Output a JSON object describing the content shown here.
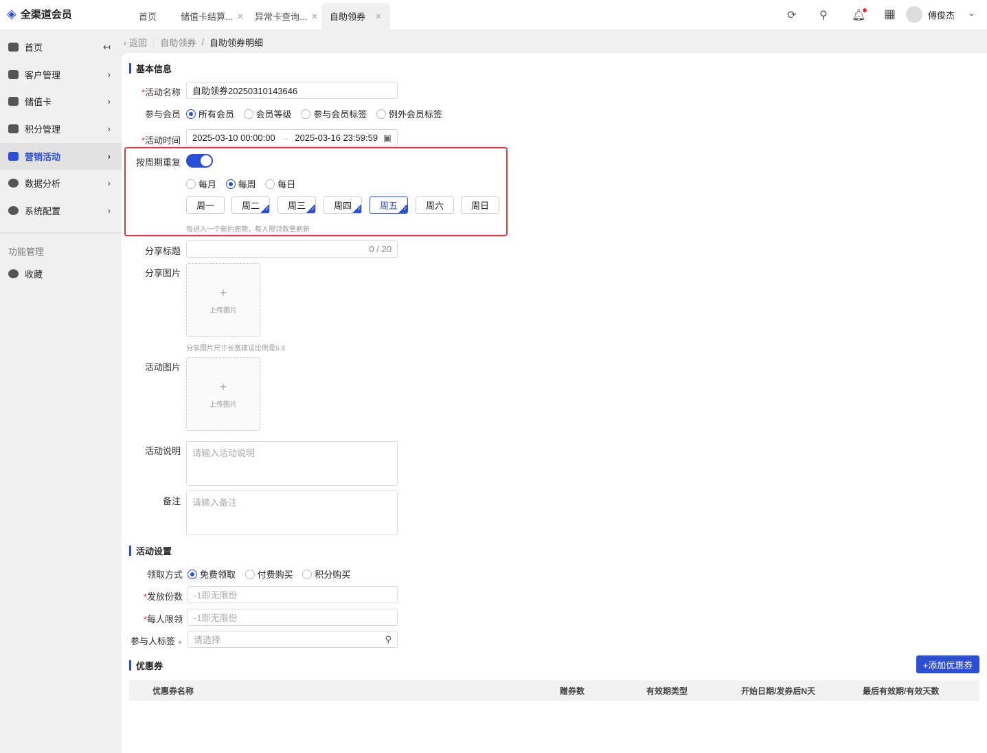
{
  "app": {
    "title": "全渠道会员"
  },
  "tabs": [
    {
      "label": "首页"
    },
    {
      "label": "储值卡结算..."
    },
    {
      "label": "异常卡查询..."
    },
    {
      "label": "自助领券"
    }
  ],
  "user": {
    "name": "傅俊杰"
  },
  "sidebar": {
    "items": [
      {
        "label": "首页"
      },
      {
        "label": "客户管理"
      },
      {
        "label": "储值卡"
      },
      {
        "label": "积分管理"
      },
      {
        "label": "营销活动"
      },
      {
        "label": "数据分析"
      },
      {
        "label": "系统配置"
      }
    ],
    "section": "功能管理",
    "fav": "收藏"
  },
  "breadcrumb": {
    "back": "返回",
    "parent": "自助领券",
    "current": "自助领券明细"
  },
  "basic": {
    "title": "基本信息",
    "name_label": "活动名称",
    "name_value": "自助领券20250310143646",
    "member_label": "参与会员",
    "member_options": [
      "所有会员",
      "会员等级",
      "参与会员标签",
      "例外会员标签"
    ],
    "time_label": "活动时间",
    "start": "2025-03-10 00:00:00",
    "end": "2025-03-16 23:59:59",
    "repeat_label": "按周期重复",
    "repeat_enabled": true,
    "period_options": [
      "每月",
      "每周",
      "每日"
    ],
    "days": [
      "周一",
      "周二",
      "周三",
      "周四",
      "周五",
      "周六",
      "周日"
    ],
    "repeat_hint": "每进入一个新的周期，每人限领数量刷新",
    "share_title_label": "分享标题",
    "share_title_count": "0 / 20",
    "share_image_label": "分享图片",
    "upload_label": "上传图片",
    "share_image_hint": "分享图片尺寸长宽建议比例是5:4",
    "activity_image_label": "活动图片",
    "desc_label": "活动说明",
    "desc_placeholder": "请输入活动说明",
    "remark_label": "备注",
    "remark_placeholder": "请输入备注"
  },
  "settings": {
    "title": "活动设置",
    "method_label": "领取方式",
    "method_options": [
      "免费领取",
      "付费购买",
      "积分购买"
    ],
    "count_label": "发放份数",
    "count_placeholder": "-1即无限份",
    "limit_label": "每人限领",
    "limit_placeholder": "-1即无限份",
    "tag_label": "参与人标签",
    "tag_placeholder": "请选择"
  },
  "coupons": {
    "title": "优惠券",
    "add_button": "+添加优惠券",
    "columns": [
      "优惠券名称",
      "赠券数",
      "有效期类型",
      "开始日期/发券后N天",
      "最后有效期/有效天数"
    ]
  },
  "colors": {
    "accent": "#2a4fd6",
    "highlight": "#e53935"
  }
}
